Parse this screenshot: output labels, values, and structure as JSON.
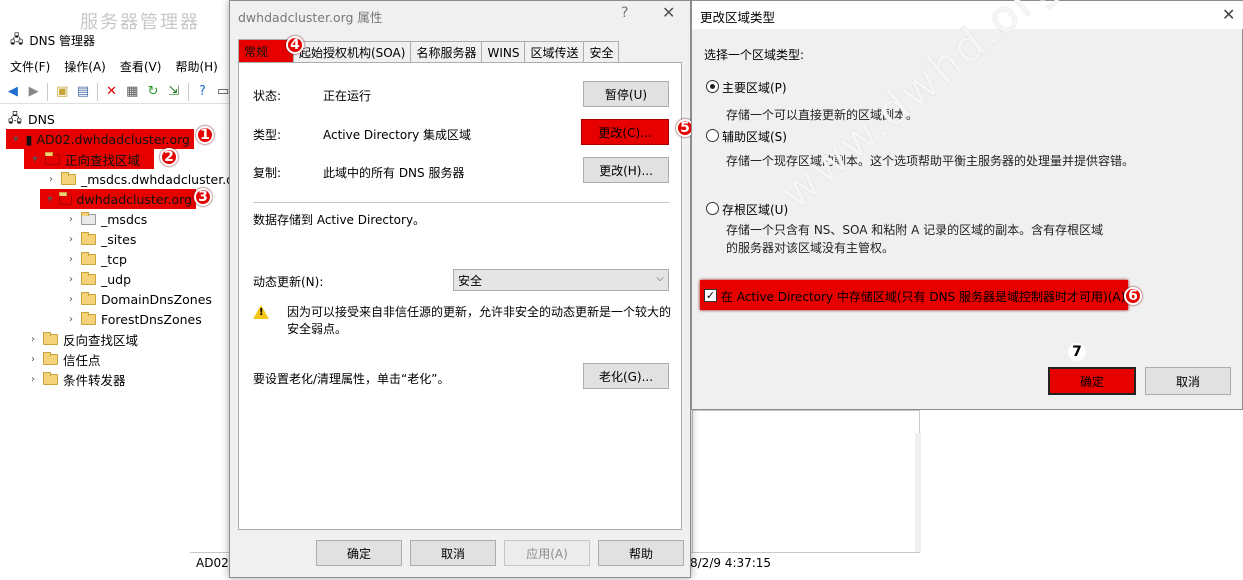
{
  "dns_manager": {
    "background_title": "服务器管理器",
    "title": "DNS 管理器",
    "menu": [
      "文件(F)",
      "操作(A)",
      "查看(V)",
      "帮助(H)"
    ],
    "toolbar_icons": [
      "back-arrow-icon",
      "forward-arrow-icon",
      "up-folder-icon",
      "show-hide-tree-icon",
      "delete-icon",
      "properties-icon",
      "refresh-icon",
      "export-list-icon",
      "help-icon",
      "console-icon"
    ],
    "tree": {
      "root": "DNS",
      "server": "AD02.dwhdadcluster.org",
      "forward_zones": "正向查找区域",
      "msdcs_zone": "_msdcs.dwhdadcluster.org",
      "zone": "dwhdadcluster.org",
      "zone_children": [
        "_msdcs",
        "_sites",
        "_tcp",
        "_udp",
        "DomainDnsZones",
        "ForestDnsZones"
      ],
      "reverse_zones": "反向查找区域",
      "trust_points": "信任点",
      "conditional_forwarders": "条件转发器"
    },
    "status_left": "AD02",
    "status_right": "8/2/9 4:37:15"
  },
  "properties_dialog": {
    "title": "dwhdadcluster.org 属性",
    "help_glyph": "?",
    "close_glyph": "✕",
    "tabs": [
      "常规",
      "起始授权机构(SOA)",
      "名称服务器",
      "WINS",
      "区域传送",
      "安全"
    ],
    "status_label": "状态:",
    "status_value": "正在运行",
    "pause_button": "暂停(U)",
    "type_label": "类型:",
    "type_value": "Active Directory 集成区域",
    "change_type_button": "更改(C)...",
    "replication_label": "复制:",
    "replication_value": "此域中的所有 DNS 服务器",
    "change_replication_button": "更改(H)...",
    "storage_text": "数据存储到 Active Directory。",
    "dynamic_update_label": "动态更新(N):",
    "dynamic_update_value": "安全",
    "warning_text": "因为可以接受来自非信任源的更新，允许非安全的动态更新是一个较大的安全弱点。",
    "aging_text": "要设置老化/清理属性，单击“老化”。",
    "aging_button": "老化(G)...",
    "ok_button": "确定",
    "cancel_button": "取消",
    "apply_button": "应用(A)",
    "help_button": "帮助"
  },
  "zone_type_dialog": {
    "title": "更改区域类型",
    "close_glyph": "✕",
    "prompt": "选择一个区域类型:",
    "options": [
      {
        "label": "主要区域(P)",
        "desc": "存储一个可以直接更新的区域副本。",
        "selected": true
      },
      {
        "label": "辅助区域(S)",
        "desc": "存储一个现存区域的副本。这个选项帮助平衡主服务器的处理量并提供容错。",
        "selected": false
      },
      {
        "label": "存根区域(U)",
        "desc": "存储一个只含有 NS、SOA 和粘附 A 记录的区域的副本。含有存根区域的服务器对该区域没有主管权。",
        "selected": false
      }
    ],
    "ad_checkbox_label": "在 Active Directory 中存储区域(只有 DNS 服务器是域控制器时才可用)(A)",
    "ad_checkbox_checked": true,
    "ok_button": "确定",
    "cancel_button": "取消"
  },
  "annotations": [
    "1",
    "2",
    "3",
    "4",
    "5",
    "6",
    "7"
  ],
  "watermark": "www.dwhd.org",
  "colors": {
    "highlight": "#e60000",
    "dialog_bg": "#f0f0f0",
    "button_bg": "#e1e1e1"
  }
}
